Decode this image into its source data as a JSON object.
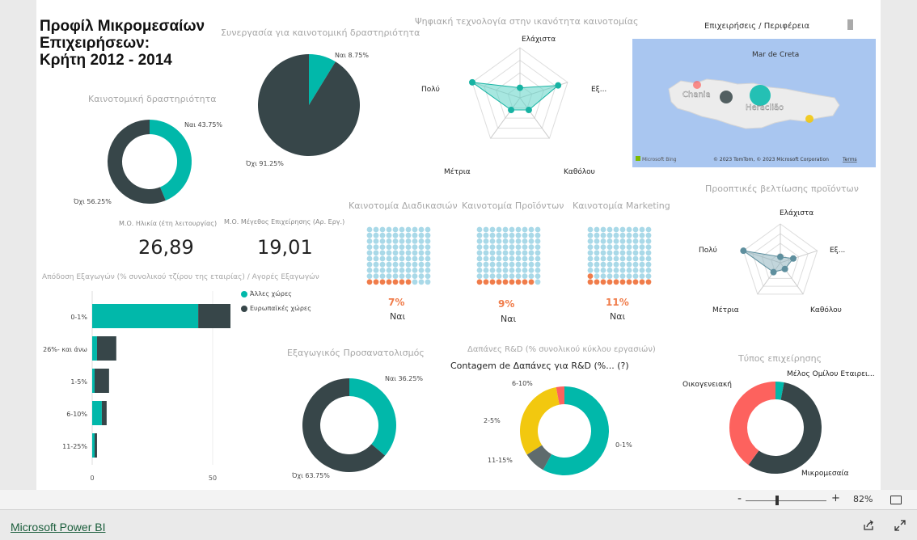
{
  "report": {
    "title": "Προφίλ Μικρομεσαίων\nΕπιχειρήσεων:\nΚρήτη 2012 - 2014"
  },
  "innovative_activity": {
    "title": "Καινοτομική δραστηριότητα",
    "labels": [
      "Ναι 43.75%",
      "Όχι 56.25%"
    ]
  },
  "cooperation": {
    "title": "Συνεργασία για καινοτομική δραστηριότητα",
    "labels": [
      "Ναι 8.75%",
      "Όχι 91.25%"
    ]
  },
  "digital_tech": {
    "title": "Ψηφιακή τεχνολογία στην ικανότητα καινοτομίας",
    "axes": [
      "Ελάχιστα",
      "Εξ...",
      "Καθόλου",
      "Μέτρια",
      "Πολύ"
    ]
  },
  "map": {
    "title": "Επιχειρήσεις / Περιφέρεια",
    "sea_label": "Mar de Creta",
    "city1": "Chania",
    "city2": "Heraclião",
    "bing": "Microsoft Bing",
    "copyright": "© 2023 TomTom, © 2023 Microsoft Corporation",
    "terms": "Terms"
  },
  "kpis": {
    "age_label": "Μ.Ο. Ηλικία (έτη λειτουργίας)",
    "age_value": "26,89",
    "size_label": "Μ.Ο. Μέγεθος Επιχείρησης (Αρ. Εργ.)",
    "size_value": "19,01"
  },
  "waffles": [
    {
      "title": "Καινοτομία Διαδικασιών",
      "pct": "7%",
      "label": "Ναι"
    },
    {
      "title": "Καινοτομία Προϊόντων",
      "pct": "9%",
      "label": "Ναι"
    },
    {
      "title": "Καινοτομία Marketing",
      "pct": "11%",
      "label": "Ναι"
    }
  ],
  "improvements": {
    "title": "Προοπτικές βελτίωσης προϊόντων",
    "axes": [
      "Ελάχιστα",
      "Εξ...",
      "Καθόλου",
      "Μέτρια",
      "Πολύ"
    ]
  },
  "exports": {
    "title": "Απόδοση Εξαγωγών (% συνολικού τζίρου της εταιρίας) / Αγορές Εξαγωγών",
    "legend": [
      "Άλλες χώρες",
      "Ευρωπαϊκές χώρες"
    ],
    "categories": [
      "0-1%",
      "26%- και άνω",
      "1-5%",
      "6-10%",
      "11-25%"
    ],
    "ticks": [
      "0",
      "50"
    ]
  },
  "export_orientation": {
    "title": "Εξαγωγικός Προσανατολισμός",
    "labels": [
      "Ναι 36.25%",
      "Όχι 63.75%"
    ]
  },
  "rd": {
    "title": "Δαπάνες R&D (% συνολικού κύκλου εργασιών)",
    "subtitle": "Contagem de Δαπάνες για R&D (%... (?)",
    "labels": [
      "6-10%",
      "2-5%",
      "11-15%",
      "0-1%"
    ]
  },
  "business_type": {
    "title": "Τύπος επιχείρησης",
    "labels": [
      "Οικογενειακή",
      "Μέλος Ομίλου Εταιρει...",
      "Μικρομεσαία"
    ]
  },
  "footer": {
    "zoom": "82%",
    "minus": "-",
    "plus": "+",
    "powerbi": "Microsoft Power BI"
  },
  "colors": {
    "teal": "#01b8aa",
    "dark": "#374649",
    "red": "#fd625e",
    "yellow": "#f2c80f",
    "orange": "#f07c4a",
    "light_blue": "#a9d9e8"
  },
  "chart_data": [
    {
      "type": "pie",
      "title": "Καινοτομική δραστηριότητα",
      "categories": [
        "Ναι",
        "Όχι"
      ],
      "values": [
        43.75,
        56.25
      ],
      "donut": true
    },
    {
      "type": "pie",
      "title": "Συνεργασία για καινοτομική δραστηριότητα",
      "categories": [
        "Ναι",
        "Όχι"
      ],
      "values": [
        8.75,
        91.25
      ]
    },
    {
      "type": "pie",
      "title": "Εξαγωγικός Προσανατολισμός",
      "categories": [
        "Ναι",
        "Όχι"
      ],
      "values": [
        36.25,
        63.75
      ],
      "donut": true
    },
    {
      "type": "pie",
      "title": "Δαπάνες R&D (% συνολικού κύκλου εργασιών)",
      "categories": [
        "0-1%",
        "6-10%",
        "2-5%",
        "11-15%"
      ],
      "values": [
        58,
        8,
        31,
        3
      ],
      "donut": true
    },
    {
      "type": "pie",
      "title": "Τύπος επιχείρησης",
      "categories": [
        "Μέλος Ομίλου Εταιρει...",
        "Μικρομεσαία",
        "Οικογενειακή"
      ],
      "values": [
        3,
        57,
        40
      ],
      "donut": true
    },
    {
      "type": "bar",
      "orientation": "horizontal",
      "stacked": true,
      "title": "Απόδοση Εξαγωγών (% συνολικού τζίρου της εταιρίας) / Αγορές Εξαγωγών",
      "categories": [
        "0-1%",
        "26%- και άνω",
        "1-5%",
        "6-10%",
        "11-25%"
      ],
      "series": [
        {
          "name": "Άλλες χώρες",
          "values": [
            44,
            2,
            1,
            4,
            1
          ]
        },
        {
          "name": "Ευρωπαϊκές χώρες",
          "values": [
            14,
            8,
            6,
            2,
            1
          ]
        }
      ],
      "xlim": [
        0,
        60
      ]
    },
    {
      "type": "radar",
      "title": "Ψηφιακή τεχνολογία στην ικανότητα καινοτομίας",
      "categories": [
        "Ελάχιστα",
        "Εξ...",
        "Καθόλου",
        "Μέτρια",
        "Πολύ"
      ],
      "values": [
        0.2,
        0.8,
        0.3,
        0.3,
        1.0
      ]
    },
    {
      "type": "radar",
      "title": "Προοπτικές βελτίωσης προϊόντων",
      "categories": [
        "Ελάχιστα",
        "Εξ...",
        "Καθόλου",
        "Μέτρια",
        "Πολύ"
      ],
      "values": [
        0.15,
        0.35,
        0.2,
        0.3,
        1.0
      ]
    },
    {
      "type": "waffle",
      "title": "Καινοτομία Διαδικασιών",
      "value": 7
    },
    {
      "type": "waffle",
      "title": "Καινοτομία Προϊόντων",
      "value": 9
    },
    {
      "type": "waffle",
      "title": "Καινοτομία Marketing",
      "value": 11
    }
  ]
}
